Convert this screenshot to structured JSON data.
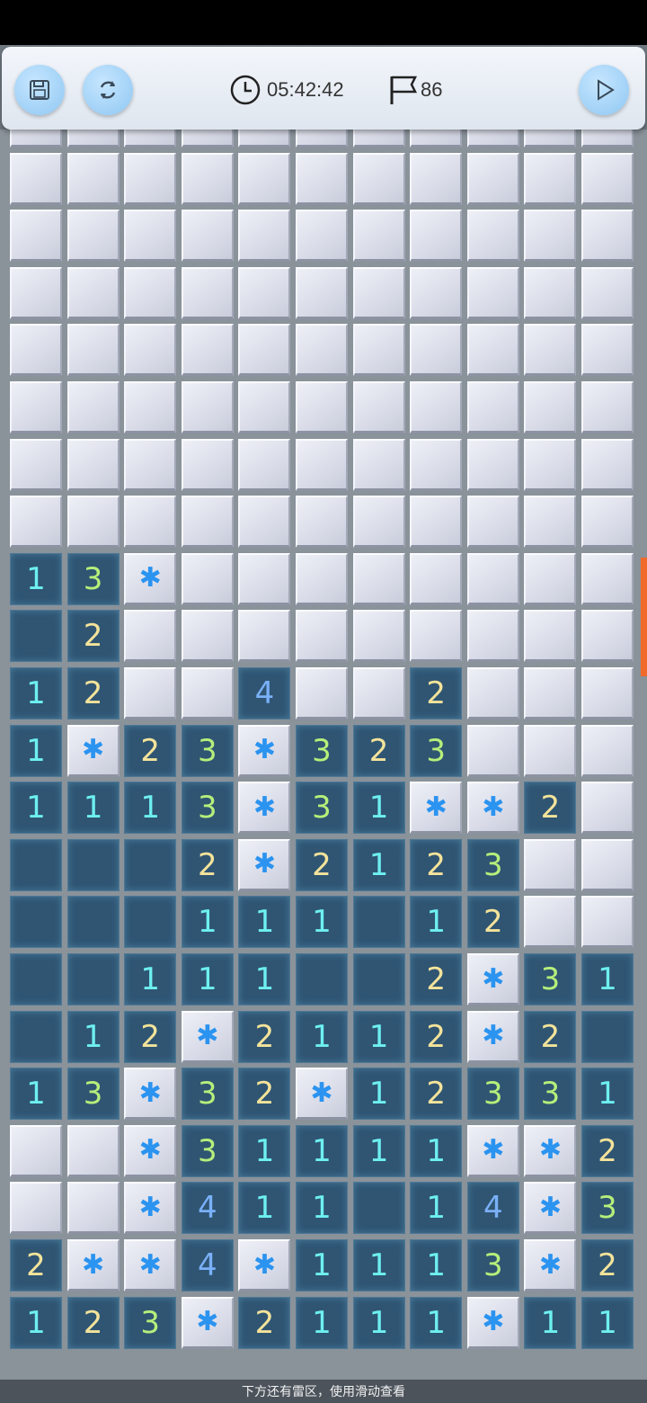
{
  "toolbar": {
    "timer": "05:42:42",
    "flags": "86",
    "save_icon": "save-icon",
    "restart_icon": "restart-icon",
    "play_icon": "play-icon",
    "accent": "#8fc7f2"
  },
  "board": {
    "rows": [
      "HHHHHHHHHHH",
      "HHHHHHHHHHH",
      "HHHHHHHHHHH",
      "HHHHHHHHHHH",
      "HHHHHHHHHHH",
      "HHHHHHHHHHH",
      "HHHHHHHHHHH",
      "13FHHHHHHHH",
      ".2HHHHHHHHH",
      "12HH4HH2HHH",
      "1F23F323HHH",
      "1113F31FF2H",
      "...2F2123HH",
      "...111.12HH",
      "..111..2F31",
      ".12F2112F2.",
      "13F32F12331",
      "HHF31111FF2",
      "HHF411.14F3",
      "2FF4F1113F2",
      "123F2111F111"
    ],
    "flag_icon": "snowflake-icon",
    "number_colors": {
      "1": "#6ef0f0",
      "2": "#f4e39a",
      "3": "#b6ef7a",
      "4": "#7ab0f8"
    }
  },
  "hint": "下方还有雷区，使用滑动查看"
}
